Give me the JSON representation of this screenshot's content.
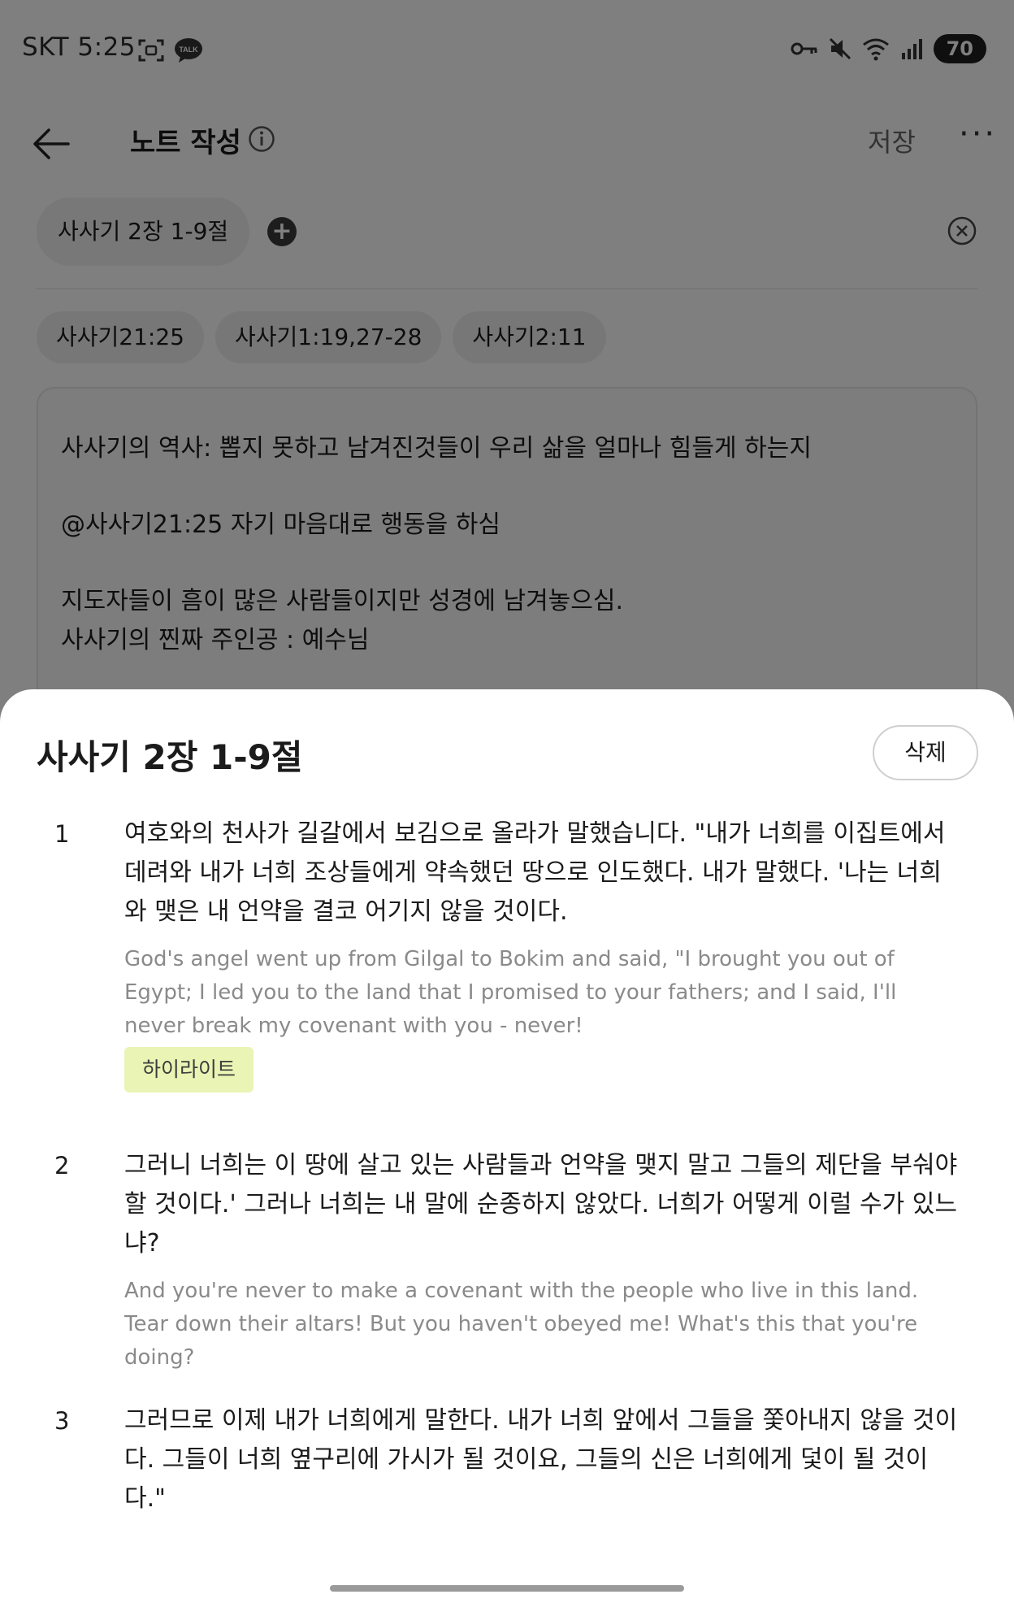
{
  "status_bar": {
    "carrier": "SKT",
    "time": "5:25",
    "talk_badge": "TALK",
    "battery": "70"
  },
  "header": {
    "title": "노트 작성",
    "save_label": "저장",
    "more_label": "···"
  },
  "passage": {
    "chip_label": "사사기 2장 1-9절",
    "add_label": "+"
  },
  "ref_tags": [
    "사사기21:25",
    "사사기1:19,27-28",
    "사사기2:11"
  ],
  "note": {
    "lines": [
      "사사기의 역사: 뽑지 못하고 남겨진것들이 우리 삶을 얼마나 힘들게 하는지",
      "@사사기21:25 자기 마음대로 행동을 하심",
      "지도자들이 흠이 많은 사람들이지만 성경에 남겨놓으심.",
      "사사기의 찐짜 주인공 : 예수님"
    ]
  },
  "sheet": {
    "title": "사사기 2장 1-9절",
    "delete_label": "삭제",
    "verses": [
      {
        "number": "1",
        "ko": "여호와의 천사가 길갈에서 보김으로 올라가 말했습니다. \"내가 너희를 이집트에서 데려와 내가 너희 조상들에게 약속했던 땅으로 인도했다. 내가 말했다. '나는 너희와 맺은 내 언약을 결코 어기지 않을 것이다.",
        "en": "God's angel went up from Gilgal to Bokim and said, \"I brought you out of Egypt; I led you to the land that I promised to your fathers; and I said, I'll never break my covenant with you - never!",
        "tag": "하이라이트"
      },
      {
        "number": "2",
        "ko": "그러니 너희는 이 땅에 살고 있는 사람들과 언약을 맺지 말고 그들의 제단을 부숴야 할 것이다.' 그러나 너희는 내 말에 순종하지 않았다. 너희가 어떻게 이럴 수가 있느냐?",
        "en": "And you're never to make a covenant with the people who live in this land. Tear down their altars! But you haven't obeyed me! What's this that you're doing?"
      },
      {
        "number": "3",
        "ko": "그러므로 이제 내가 너희에게 말한다. 내가 너희 앞에서 그들을 쫓아내지 않을 것이다. 그들이 너희 옆구리에 가시가 될 것이요, 그들의 신은 너희에게 덫이 될 것이다.\""
      }
    ]
  }
}
